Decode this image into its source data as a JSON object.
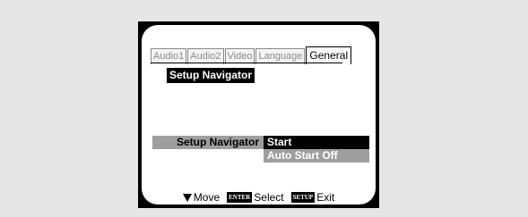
{
  "tabs": [
    {
      "label": "Audio1",
      "active": false
    },
    {
      "label": "Audio2",
      "active": false
    },
    {
      "label": "Video",
      "active": false
    },
    {
      "label": "Language",
      "active": false
    },
    {
      "label": "General",
      "active": true
    }
  ],
  "section_title": "Setup Navigator",
  "setting": {
    "label": "Setup Navigator",
    "options": [
      "Start",
      "Auto Start Off"
    ],
    "selected": "Start"
  },
  "footer": {
    "move_label": "Move",
    "enter_key": "ENTER",
    "select_label": "Select",
    "setup_key": "SETUP",
    "exit_label": "Exit"
  },
  "colors": {
    "background": "#e6e6e6",
    "frame": "#000000",
    "highlight": "#000000",
    "inactive_option": "#9e9e9e"
  }
}
